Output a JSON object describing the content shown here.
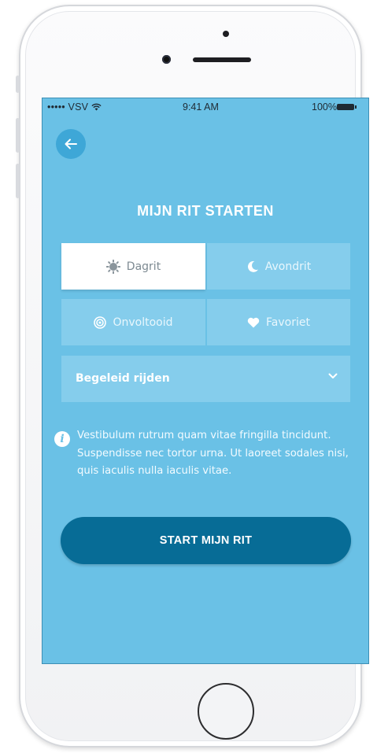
{
  "status_bar": {
    "carrier": "••••• VSV",
    "time": "9:41 AM",
    "battery": "100%"
  },
  "page": {
    "title": "MIJN RIT STARTEN"
  },
  "options": {
    "row1": [
      {
        "label": "Dagrit",
        "icon": "sun-icon",
        "selected": true
      },
      {
        "label": "Avondrit",
        "icon": "moon-icon",
        "selected": false
      }
    ],
    "row2": [
      {
        "label": "Onvoltooid",
        "icon": "target-icon",
        "selected": false
      },
      {
        "label": "Favoriet",
        "icon": "heart-icon",
        "selected": false
      }
    ]
  },
  "dropdown": {
    "value": "Begeleid rijden"
  },
  "info": {
    "text": "Vestibulum rutrum quam vitae fringilla tincidunt. Suspendisse nec tortor urna. Ut laoreet sodales nisi, quis iaculis nulla iaculis vitae."
  },
  "cta": {
    "label": "START MIJN RIT"
  },
  "colors": {
    "screen_bg": "#6ac1e6",
    "tile_bg": "#85cdec",
    "cta_bg": "#076c96"
  }
}
